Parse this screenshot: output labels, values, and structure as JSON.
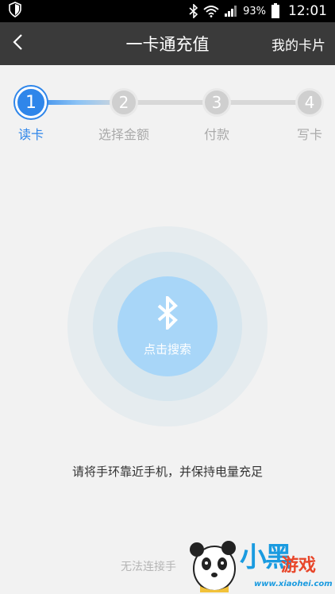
{
  "status_bar": {
    "battery_percent": "93%",
    "time": "12:01"
  },
  "header": {
    "title": "一卡通充值",
    "right_action": "我的卡片"
  },
  "steps": [
    {
      "number": "1",
      "label": "读卡",
      "active": true
    },
    {
      "number": "2",
      "label": "选择金额",
      "active": false
    },
    {
      "number": "3",
      "label": "付款",
      "active": false
    },
    {
      "number": "4",
      "label": "写卡",
      "active": false
    }
  ],
  "search": {
    "label": "点击搜索",
    "icon": "bluetooth-icon"
  },
  "hint": "请将手环靠近手机，并保持电量充足",
  "cannot_connect": "无法连接手",
  "watermark": {
    "text1": "小黑",
    "text2": "游戏",
    "url": "www.xiaohei.com"
  },
  "colors": {
    "accent": "#2f86ea",
    "header_bg": "#3a3a3a",
    "background": "#f2f2f2",
    "search_button": "#a8d6f8"
  }
}
